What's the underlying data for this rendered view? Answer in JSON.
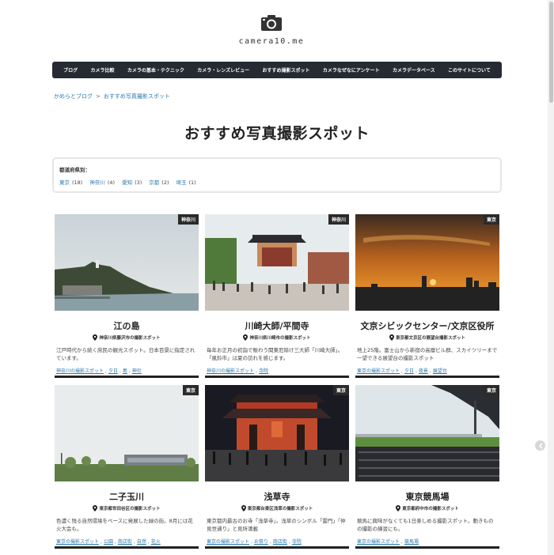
{
  "site": {
    "logo_icon": "camera-icon",
    "name": "camera10.me"
  },
  "nav": {
    "items": [
      {
        "label": "ブログ"
      },
      {
        "label": "カメラ比較"
      },
      {
        "label": "カメラの基本・テクニック"
      },
      {
        "label": "カメラ・レンズレビュー"
      },
      {
        "label": "おすすめ撮影スポット"
      },
      {
        "label": "カメラなぜなにアンケート"
      },
      {
        "label": "カメラデータベース"
      },
      {
        "label": "このサイトについて"
      }
    ]
  },
  "breadcrumb": {
    "home": "かめらとブログ",
    "separator": ">",
    "current": "おすすめ写真撮影スポット"
  },
  "page": {
    "title": "おすすめ写真撮影スポット"
  },
  "filter": {
    "label": "都道府県別：",
    "items": [
      {
        "name": "東京",
        "count": "(18)"
      },
      {
        "name": "神奈川",
        "count": "(4)"
      },
      {
        "name": "愛知",
        "count": "(3)"
      },
      {
        "name": "京都",
        "count": "(2)"
      },
      {
        "name": "埼玉",
        "count": "(1)"
      }
    ]
  },
  "cards": [
    {
      "badge": "神奈川",
      "title": "江の島",
      "location": "神奈川県藤沢市の撮影スポット",
      "description": "江戸時代から続く庶民の観光スポット。日本百景に指定されています。",
      "tags": [
        "神奈川の撮影スポット",
        "夕日",
        "島",
        "神社"
      ]
    },
    {
      "badge": "神奈川",
      "title": "川崎大師/平間寺",
      "location": "神奈川県川崎市の撮影スポット",
      "description": "毎年お正月の初詣で賑わう関東厄除け三大師「川崎大師」。「風鈴市」は夏の訪れを感じます。",
      "tags": [
        "神奈川の撮影スポット",
        "寺院"
      ]
    },
    {
      "badge": "東京",
      "title": "文京シビックセンター/文京区役所",
      "location": "東京都文京区の展望台撮影スポット",
      "description": "地上25階。富士山から新宿の高層ビル群、スカイツリーまで一望できる展望台の撮影スポット",
      "tags": [
        "東京の撮影スポット",
        "夕日",
        "夜景",
        "展望台"
      ]
    },
    {
      "badge": "東京",
      "title": "二子玉川",
      "location": "東京都世田谷区の撮影スポット",
      "description": "色濃く残る自然環境をベースに発展した緑の街。8月には花火大会も。",
      "tags": [
        "東京の撮影スポット",
        "公園",
        "商店街",
        "自然",
        "花火"
      ]
    },
    {
      "badge": "東京",
      "title": "浅草寺",
      "location": "東京都台東区浅草の撮影スポット",
      "description": "東京都内最古のお寺「浅草寺」。浅草のシンボル「雷門」「仲見世通り」と見所満載",
      "tags": [
        "東京の撮影スポット",
        "お祭り",
        "商店街",
        "寺院"
      ]
    },
    {
      "badge": "東京",
      "title": "東京競馬場",
      "location": "東京都府中市の撮影スポット",
      "description": "競馬に興味がなくても1日楽しめる撮影スポット。動きものの撮影の練習にも。",
      "tags": [
        "東京の撮影スポット",
        "競馬場"
      ]
    }
  ],
  "colors": {
    "nav_bg": "#252a33",
    "link": "#2a7ab0",
    "badge_bg": "#2a2a2a"
  }
}
